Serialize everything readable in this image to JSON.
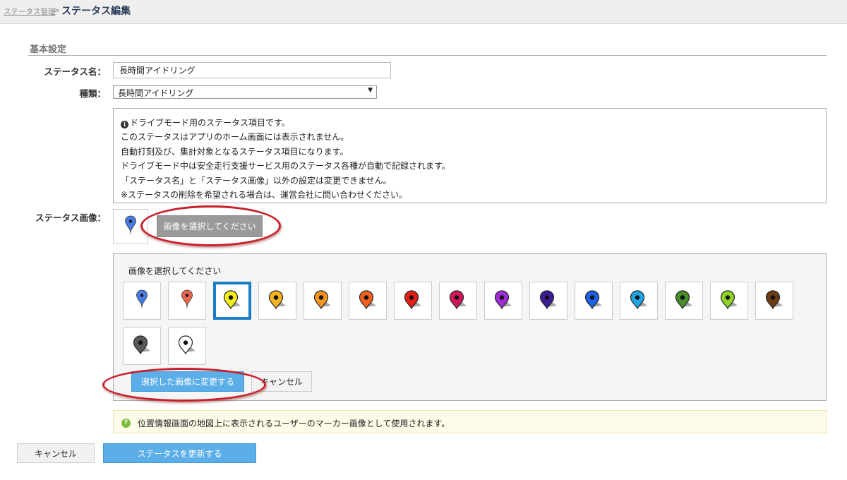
{
  "breadcrumb": {
    "parent": "ステータス管理",
    "separator": ">",
    "current": "ステータス編集"
  },
  "form": {
    "section_title": "基本設定",
    "name_label": "ステータス名：",
    "name_value": "長時間アイドリング",
    "type_label": "種類：",
    "type_value": "長時間アイドリング",
    "image_label": "ステータス画像："
  },
  "info": {
    "lines": [
      "ドライブモード用のステータス項目です。",
      "このステータスはアプリのホーム画面には表示されません。",
      "自動打刻及び、集計対象となるステータス項目になります。",
      "ドライブモード中は安全走行支援サービス用のステータス各種が自動で記録されます。",
      "「ステータス名」と「ステータス画像」以外の設定は変更できません。",
      "※ステータスの削除を希望される場合は、運営会社に問い合わせください。"
    ]
  },
  "image_select_button": "画像を選択してください",
  "preview_marker": {
    "color": "#4a7be0",
    "style": "pin"
  },
  "picker": {
    "title": "画像を選択してください",
    "apply_button": "選択した画像に変更する",
    "cancel_button": "キャンセル",
    "selected_index": 2,
    "markers": [
      {
        "color": "#4a7be0",
        "style": "pin",
        "icon": "blue-pin-marker-icon"
      },
      {
        "color": "#e8664e",
        "style": "pin",
        "icon": "red-pin-marker-icon"
      },
      {
        "color": "#f2ee1e",
        "style": "drop",
        "icon": "yellow-marker-icon"
      },
      {
        "color": "#f3b420",
        "style": "drop",
        "icon": "amber-marker-icon"
      },
      {
        "color": "#f59320",
        "style": "drop",
        "icon": "orange-marker-icon"
      },
      {
        "color": "#f0601c",
        "style": "drop",
        "icon": "dark-orange-marker-icon"
      },
      {
        "color": "#e41e16",
        "style": "drop",
        "icon": "red-marker-icon"
      },
      {
        "color": "#d0175a",
        "style": "drop",
        "icon": "crimson-marker-icon"
      },
      {
        "color": "#9f2cd6",
        "style": "drop",
        "icon": "purple-marker-icon"
      },
      {
        "color": "#3c1e96",
        "style": "drop",
        "icon": "indigo-marker-icon"
      },
      {
        "color": "#1b62e6",
        "style": "drop",
        "icon": "blue-marker-icon"
      },
      {
        "color": "#1ea6e4",
        "style": "drop",
        "icon": "sky-blue-marker-icon"
      },
      {
        "color": "#4a8c2a",
        "style": "drop",
        "icon": "green-marker-icon"
      },
      {
        "color": "#8fd22a",
        "style": "drop",
        "icon": "lime-marker-icon"
      },
      {
        "color": "#6b3a12",
        "style": "drop",
        "icon": "brown-marker-icon"
      },
      {
        "color": "#5a5a5a",
        "style": "drop",
        "icon": "gray-marker-icon"
      },
      {
        "color": "#ffffff",
        "style": "drop",
        "icon": "white-marker-icon"
      }
    ]
  },
  "notice": {
    "text": "位置情報画面の地図上に表示されるユーザーのマーカー画像として使用されます。"
  },
  "footer": {
    "cancel_button": "キャンセル",
    "update_button": "ステータスを更新する"
  },
  "colors": {
    "primary_button": "#5baee8",
    "selected_border": "#1b7dc4",
    "annotation_ring": "#c8202a"
  }
}
